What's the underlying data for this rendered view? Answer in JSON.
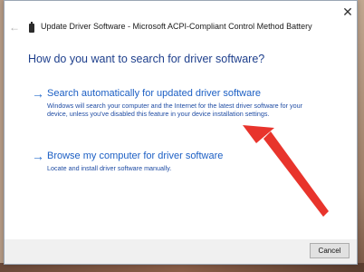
{
  "window": {
    "title": "Update Driver Software - Microsoft ACPI-Compliant Control Method Battery",
    "close_glyph": "✕",
    "back_glyph": "←"
  },
  "main": {
    "heading": "How do you want to search for driver software?",
    "options": [
      {
        "arrow": "→",
        "title": "Search automatically for updated driver software",
        "description": "Windows will search your computer and the Internet for the latest driver software for your device, unless you've disabled this feature in your device installation settings."
      },
      {
        "arrow": "→",
        "title": "Browse my computer for driver software",
        "description": "Locate and install driver software manually."
      }
    ]
  },
  "footer": {
    "cancel_label": "Cancel"
  },
  "colors": {
    "heading": "#1e3f8c",
    "link": "#1c5fc4",
    "annotation_arrow": "#e8342c"
  },
  "icons": {
    "device": "battery-device-icon",
    "back": "back-arrow-icon",
    "close": "close-icon",
    "option_arrow": "right-arrow-icon",
    "annotation": "red-annotation-arrow"
  }
}
